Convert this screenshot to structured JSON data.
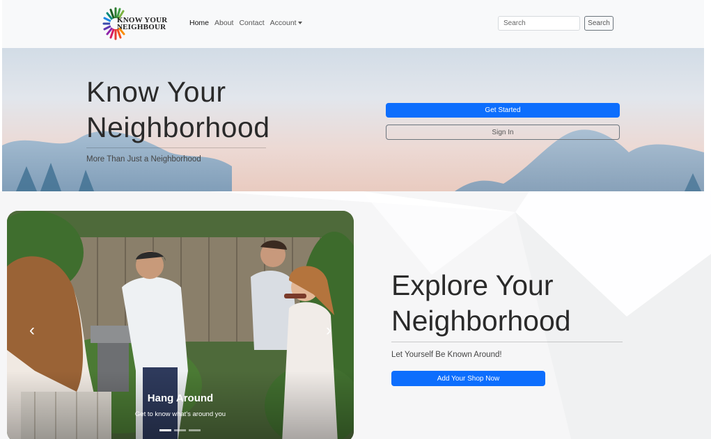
{
  "navbar": {
    "logo_text_line1": "KNOW YOUR",
    "logo_text_line2": "NEIGHBOUR",
    "links": [
      {
        "label": "Home"
      },
      {
        "label": "About"
      },
      {
        "label": "Contact"
      },
      {
        "label": "Account"
      }
    ],
    "search": {
      "placeholder": "Search",
      "button_label": "Search"
    }
  },
  "hero": {
    "title_line1": "Know Your",
    "title_line2": "Neighborhood",
    "subtitle": "More Than Just a Neighborhood",
    "get_started_label": "Get Started",
    "sign_in_label": "Sign In"
  },
  "carousel": {
    "caption_title": "Hang Around",
    "caption_subtitle": "Get to know what's around you",
    "slide_count": 3,
    "active_slide": 1
  },
  "explore": {
    "title_line1": "Explore Your",
    "title_line2": "Neighborhood",
    "subtitle": "Let Yourself Be Known Around!",
    "button_label": "Add Your Shop Now"
  },
  "colors": {
    "primary": "#0d6efd",
    "navbar_bg": "#f8f9fa",
    "text_dark": "#2a2a2a"
  }
}
